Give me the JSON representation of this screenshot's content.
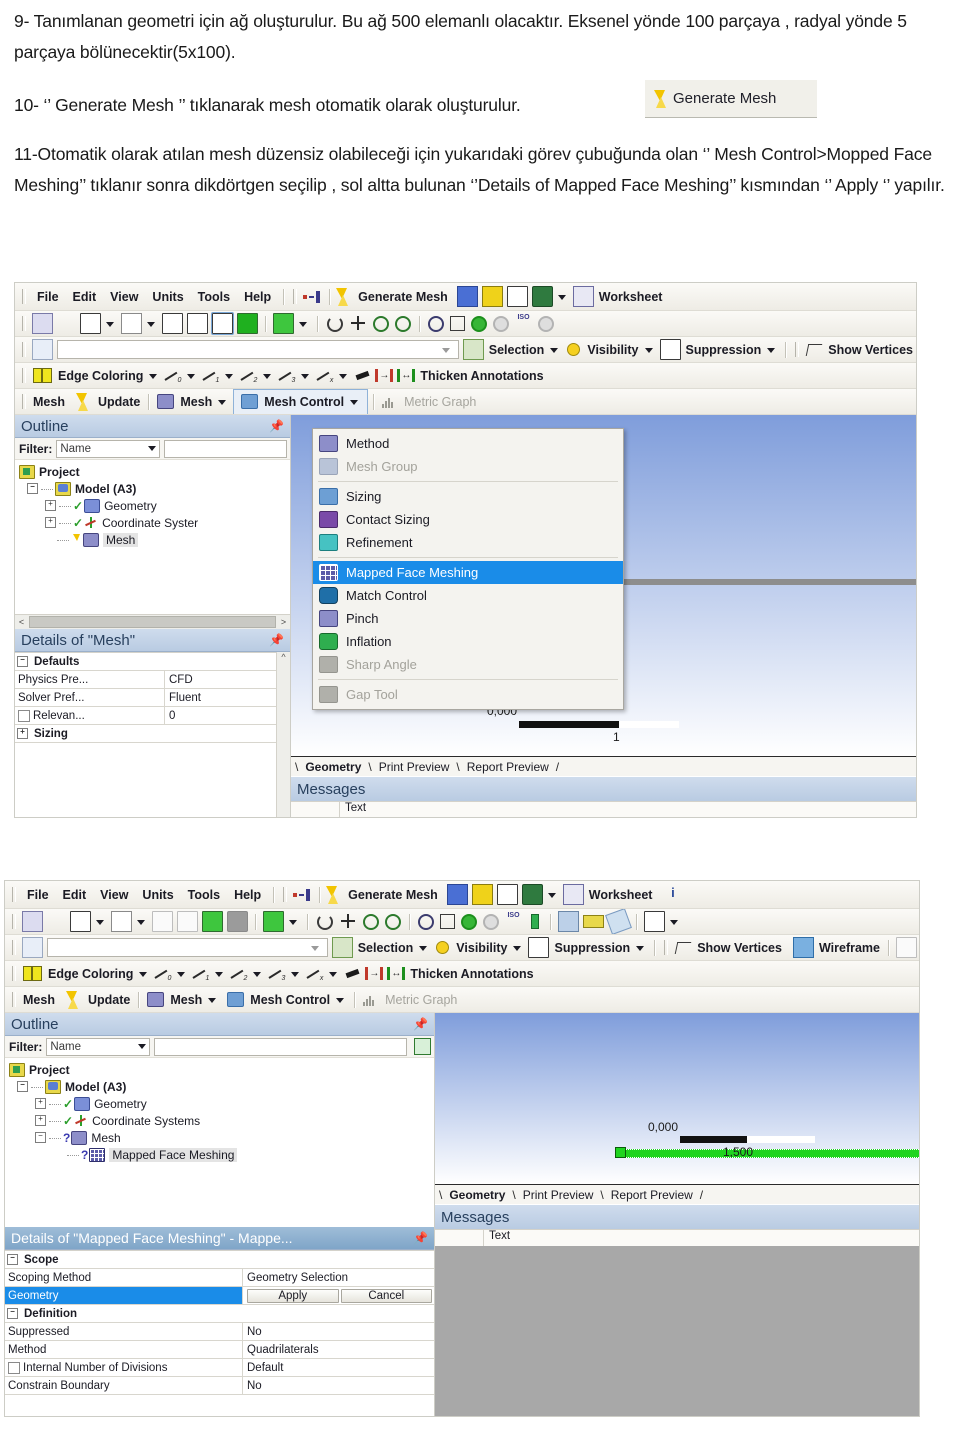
{
  "document": {
    "paragraphs": [
      "9- Tanımlanan geometri için ağ oluşturulur. Bu ağ 500 elemanlı olacaktır. Eksenel yönde 100 parçaya , radyal yönde 5 parçaya bölünecektir(5x100).",
      "10- ‘’ Generate Mesh ’’ tıklanarak mesh otomatik olarak  oluşturulur.",
      "11-Otomatik olarak atılan mesh düzensiz olabileceği için yukarıdaki görev çubuğunda olan ‘’ Mesh Control>Mopped Face Meshing’’ tıklanır  sonra  dikdörtgen seçilip , sol altta bulunan ‘’Details of Mapped Face Meshing’’ kısmından ‘’ Apply ‘’ yapılır."
    ],
    "inline_button": {
      "label": "Generate Mesh",
      "icon": "lightning-bolt-icon"
    }
  },
  "screenshot1": {
    "menubar": [
      "File",
      "Edit",
      "View",
      "Units",
      "Tools",
      "Help"
    ],
    "toolbar_labels": {
      "generate_mesh": "Generate Mesh",
      "worksheet": "Worksheet",
      "selection": "Selection",
      "visibility": "Visibility",
      "suppression": "Suppression",
      "show_vertices": "Show Vertices",
      "edge_coloring": "Edge Coloring",
      "thicken_annotations": "Thicken Annotations"
    },
    "context_toolbar": {
      "mesh_label": "Mesh",
      "update": "Update",
      "mesh_menu": "Mesh",
      "mesh_control": "Mesh Control",
      "metric_graph": "Metric Graph"
    },
    "outline": {
      "title": "Outline",
      "pin": "pin-icon",
      "filter_label": "Filter:",
      "filter_value": "Name",
      "tree": [
        {
          "label": "Project",
          "icon": "project-folder-icon",
          "bold": true
        },
        {
          "label": "Model (A3)",
          "icon": "model-icon",
          "bold": true
        },
        {
          "label": "Geometry",
          "icon": "geometry-icon",
          "status": "check"
        },
        {
          "label": "Coordinate Syster",
          "icon": "coordinate-system-icon",
          "status": "check"
        },
        {
          "label": "Mesh",
          "icon": "mesh-icon",
          "status": "bolt",
          "selected": true
        }
      ]
    },
    "details": {
      "title": "Details of \"Mesh\"",
      "rows": [
        {
          "type": "group",
          "key": "Defaults"
        },
        {
          "type": "kv",
          "key": "Physics Pre...",
          "value": "CFD"
        },
        {
          "type": "kv",
          "key": "Solver Pref...",
          "value": "Fluent"
        },
        {
          "type": "kv",
          "key": "Relevan...",
          "value": "0",
          "checkbox": true
        },
        {
          "type": "group",
          "key": "Sizing",
          "collapsed": true
        }
      ]
    },
    "mesh_control_menu": [
      {
        "label": "Method",
        "icon": "method-icon",
        "enabled": true
      },
      {
        "label": "Mesh Group",
        "icon": "mesh-group-icon",
        "enabled": false
      },
      {
        "divider": true
      },
      {
        "label": "Sizing",
        "icon": "sizing-icon",
        "enabled": true
      },
      {
        "label": "Contact Sizing",
        "icon": "contact-sizing-icon",
        "enabled": true
      },
      {
        "label": "Refinement",
        "icon": "refinement-icon",
        "enabled": true
      },
      {
        "divider": true
      },
      {
        "label": "Mapped Face Meshing",
        "icon": "mapped-face-meshing-icon",
        "enabled": true,
        "highlighted": true
      },
      {
        "label": "Match Control",
        "icon": "match-control-icon",
        "enabled": true
      },
      {
        "label": "Pinch",
        "icon": "pinch-icon",
        "enabled": true
      },
      {
        "label": "Inflation",
        "icon": "inflation-icon",
        "enabled": true
      },
      {
        "label": "Sharp Angle",
        "icon": "sharp-angle-icon",
        "enabled": false
      },
      {
        "divider": true
      },
      {
        "label": "Gap Tool",
        "icon": "gap-tool-icon",
        "enabled": false
      }
    ],
    "viewport": {
      "ruler_min": "0,000",
      "ruler_max": "1"
    },
    "tabs": [
      "Geometry",
      "Print Preview",
      "Report Preview"
    ],
    "messages": {
      "title": "Messages",
      "column": "Text"
    }
  },
  "screenshot2": {
    "menubar": [
      "File",
      "Edit",
      "View",
      "Units",
      "Tools",
      "Help"
    ],
    "toolbar_labels": {
      "generate_mesh": "Generate Mesh",
      "worksheet": "Worksheet",
      "selection": "Selection",
      "visibility": "Visibility",
      "suppression": "Suppression",
      "show_vertices": "Show Vertices",
      "wireframe": "Wireframe",
      "edge_coloring": "Edge Coloring",
      "thicken_annotations": "Thicken Annotations"
    },
    "context_toolbar": {
      "mesh_label": "Mesh",
      "update": "Update",
      "mesh_menu": "Mesh",
      "mesh_control": "Mesh Control",
      "metric_graph": "Metric Graph"
    },
    "outline": {
      "title": "Outline",
      "filter_label": "Filter:",
      "filter_value": "Name",
      "tree": [
        {
          "label": "Project",
          "icon": "project-folder-icon",
          "bold": true
        },
        {
          "label": "Model (A3)",
          "icon": "model-icon",
          "bold": true
        },
        {
          "label": "Geometry",
          "icon": "geometry-icon",
          "status": "check"
        },
        {
          "label": "Coordinate Systems",
          "icon": "coordinate-system-icon",
          "status": "check"
        },
        {
          "label": "Mesh",
          "icon": "mesh-icon",
          "status": "question"
        },
        {
          "label": "Mapped Face Meshing",
          "icon": "mapped-face-meshing-icon",
          "status": "question",
          "selected": true
        }
      ]
    },
    "details": {
      "title": "Details of \"Mapped Face Meshing\" - Mappe...",
      "rows": [
        {
          "type": "group",
          "key": "Scope"
        },
        {
          "type": "kv",
          "key": "Scoping Method",
          "value": "Geometry Selection"
        },
        {
          "type": "buttons",
          "key": "Geometry",
          "selected": true,
          "buttons": [
            "Apply",
            "Cancel"
          ]
        },
        {
          "type": "group",
          "key": "Definition"
        },
        {
          "type": "kv",
          "key": "Suppressed",
          "value": "No"
        },
        {
          "type": "kv",
          "key": "Method",
          "value": "Quadrilaterals"
        },
        {
          "type": "kv",
          "key": "Internal Number of Divisions",
          "value": "Default",
          "checkbox": true
        },
        {
          "type": "kv",
          "key": "Constrain Boundary",
          "value": "No"
        }
      ]
    },
    "viewport": {
      "ruler_min": "0,000",
      "ruler_max": "1,500"
    },
    "tabs": [
      "Geometry",
      "Print Preview",
      "Report Preview"
    ],
    "messages": {
      "title": "Messages",
      "column": "Text"
    }
  }
}
